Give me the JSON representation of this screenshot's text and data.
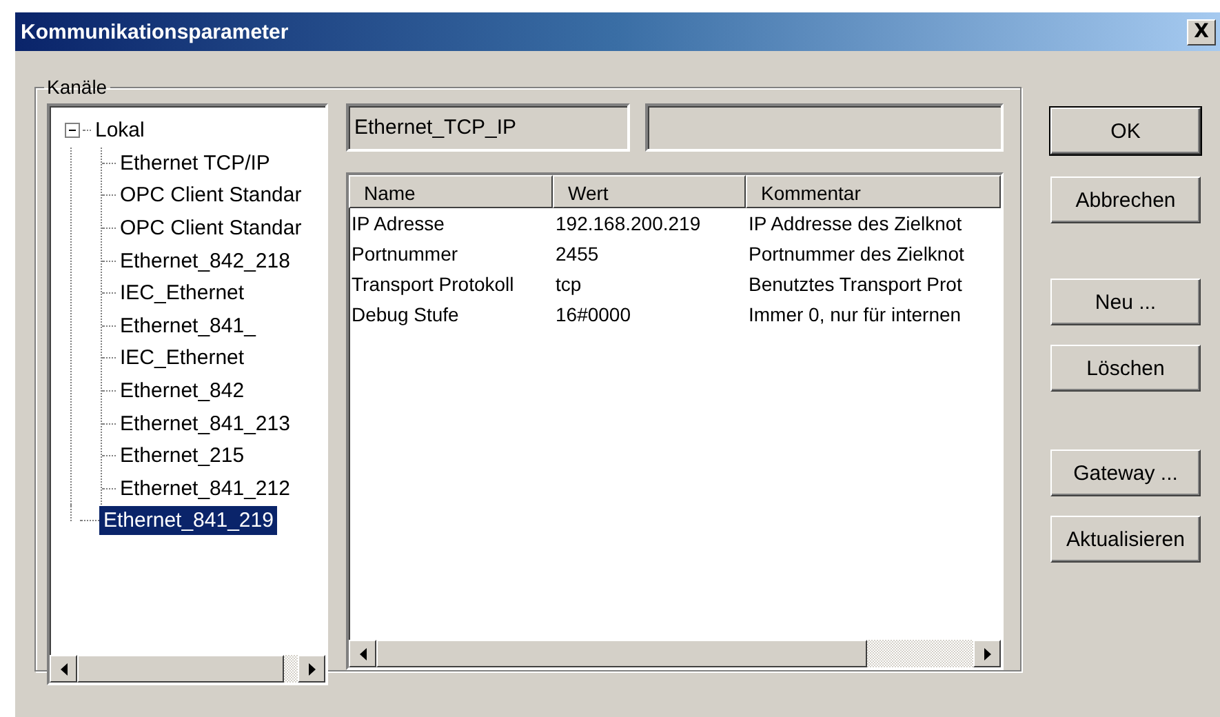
{
  "window": {
    "title": "Kommunikationsparameter",
    "close": "X"
  },
  "channels": {
    "label": "Kanäle",
    "tree": [
      {
        "label": "Lokal",
        "expanded": true,
        "selected": false,
        "children": [
          {
            "label": "Ethernet TCP/IP",
            "selected": false
          },
          {
            "label": "OPC Client Standar",
            "selected": false
          },
          {
            "label": "OPC Client Standar",
            "selected": false
          },
          {
            "label": "Ethernet_842_218",
            "selected": false
          },
          {
            "label": "IEC_Ethernet",
            "selected": false
          },
          {
            "label": "Ethernet_841_",
            "selected": false
          },
          {
            "label": "IEC_Ethernet",
            "selected": false
          },
          {
            "label": "Ethernet_842",
            "selected": false
          },
          {
            "label": "Ethernet_841_213",
            "selected": false
          },
          {
            "label": "Ethernet_215",
            "selected": false
          },
          {
            "label": "Ethernet_841_212",
            "selected": false
          }
        ]
      },
      {
        "label": "Ethernet_841_219",
        "selected": true
      }
    ]
  },
  "channel_name": "Ethernet_TCP_IP",
  "table": {
    "columns": [
      "Name",
      "Wert",
      "Kommentar"
    ],
    "rows": [
      [
        "IP Adresse",
        "192.168.200.219",
        "IP Addresse des Zielknot"
      ],
      [
        "Portnummer",
        "2455",
        "Portnummer des Zielknot"
      ],
      [
        "Transport Protokoll",
        "tcp",
        "Benutztes Transport Prot"
      ],
      [
        "Debug Stufe",
        "16#0000",
        "Immer 0, nur für internen"
      ]
    ]
  },
  "buttons": [
    {
      "label": "OK",
      "default": true
    },
    {
      "label": "Abbrechen",
      "default": false
    },
    {
      "label": "Neu ...",
      "default": false
    },
    {
      "label": "Löschen",
      "default": false
    },
    {
      "label": "Gateway ...",
      "default": false
    },
    {
      "label": "Aktualisieren",
      "default": false
    }
  ]
}
